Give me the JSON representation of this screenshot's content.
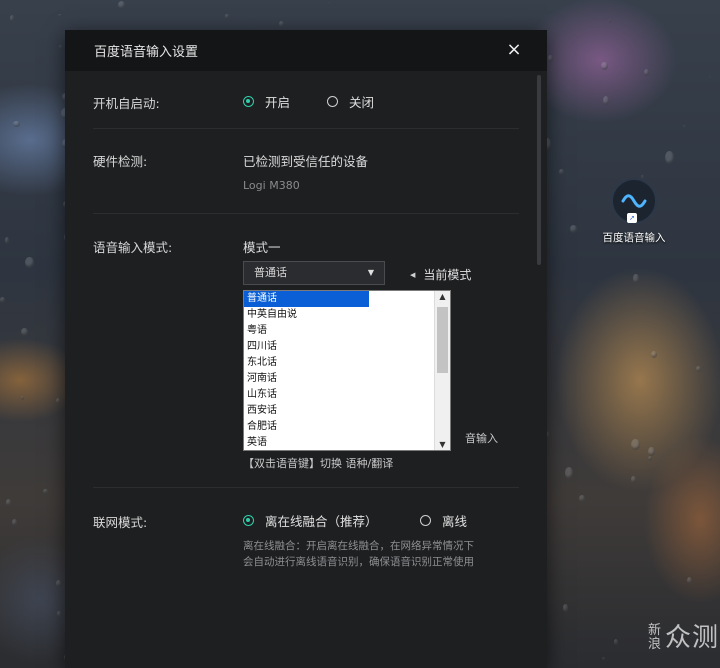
{
  "dialog": {
    "title": "百度语音输入设置",
    "close_icon": "×"
  },
  "startup": {
    "label": "开机自启动:",
    "options": [
      {
        "label": "开启",
        "selected": true
      },
      {
        "label": "关闭",
        "selected": false
      }
    ]
  },
  "hardware": {
    "label": "硬件检测:",
    "status": "已检测到受信任的设备",
    "device": "Logi M380"
  },
  "voice_mode": {
    "label": "语音输入模式:",
    "mode_name": "模式一",
    "selected_value": "普通话",
    "hint": "当前模式",
    "options": [
      "普通话",
      "中英自由说",
      "粤语",
      "四川话",
      "东北话",
      "河南话",
      "山东话",
      "西安话",
      "合肥话",
      "英语"
    ],
    "partial_text_1": "音输入",
    "shortcut_text": "【双击语音键】切换 语种/翻译"
  },
  "network": {
    "label": "联网模式:",
    "options": [
      {
        "label": "离在线融合（推荐）",
        "selected": true
      },
      {
        "label": "离线",
        "selected": false
      }
    ],
    "description": "离在线融合：开启离在线融合，在网络异常情况下会自动进行离线语音识别，确保语音识别正常使用"
  },
  "desktop_icon": {
    "label": "百度语音输入"
  },
  "watermark": {
    "line1": "新",
    "line2": "浪",
    "brand": "众测"
  },
  "colors": {
    "accent": "#2fd0ab",
    "dialog_bg": "#1e1f21",
    "titlebar_bg": "#141517",
    "selection_blue": "#0a5fd6"
  }
}
